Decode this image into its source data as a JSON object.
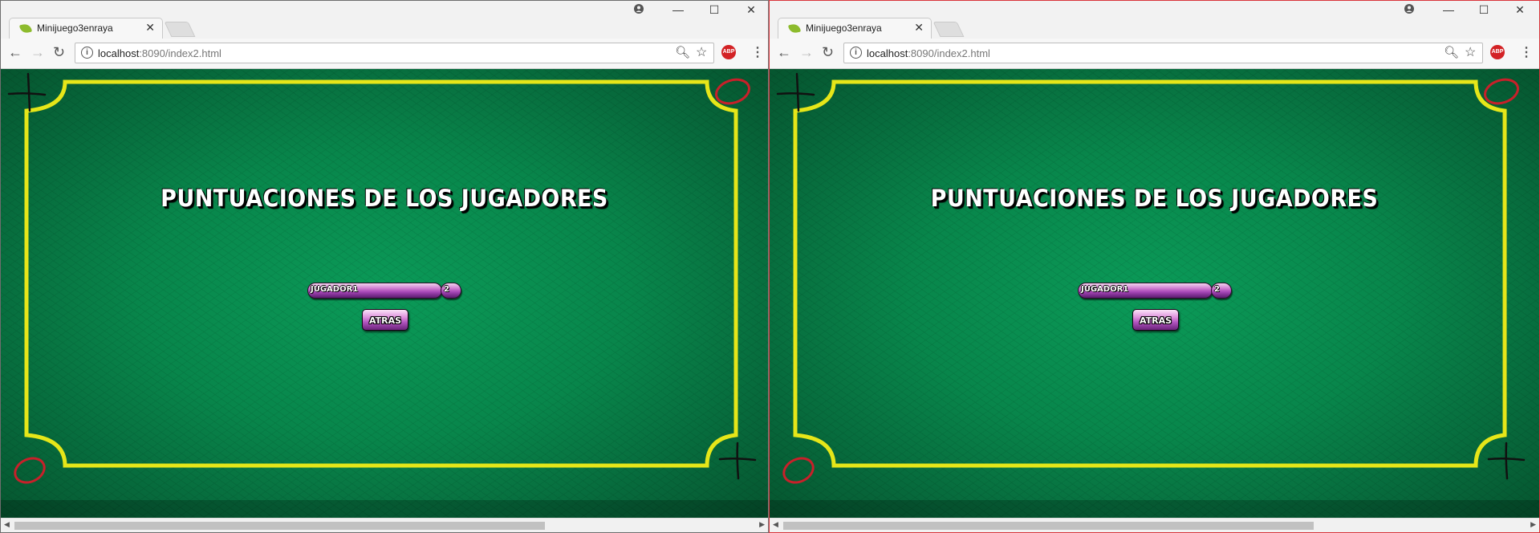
{
  "windows": [
    {
      "tab_title": "Minijuego3enraya",
      "url_host": "localhost",
      "url_path": ":8090/index2.html",
      "heading": "PUNTUACIONES DE LOS JUGADORES",
      "player_name": "JUGADOR1",
      "player_score": "2",
      "back_button": "ATRAS",
      "abp_label": "ABP"
    },
    {
      "tab_title": "Minijuego3enraya",
      "url_host": "localhost",
      "url_path": ":8090/index2.html",
      "heading": "PUNTUACIONES DE LOS JUGADORES",
      "player_name": "JUGADOR1",
      "player_score": "2",
      "back_button": "ATRAS",
      "abp_label": "ABP"
    }
  ],
  "colors": {
    "board_green": "#08864b",
    "frame_yellow": "#e6e619",
    "pill_purple": "#a546b6",
    "circle_red": "#c8202a"
  },
  "icons": [
    "leaf-favicon-icon",
    "close-icon",
    "account-icon",
    "minimize-icon",
    "maximize-icon",
    "back-arrow-icon",
    "forward-arrow-icon",
    "reload-icon",
    "info-icon",
    "zoom-icon",
    "star-icon",
    "adblock-icon",
    "menu-icon"
  ]
}
